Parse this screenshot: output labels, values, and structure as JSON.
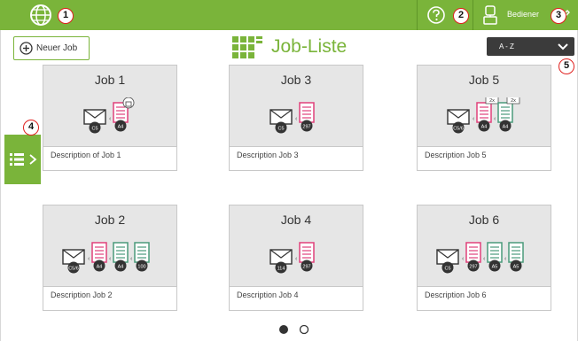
{
  "topbar": {
    "user_label": "Bediener",
    "bg_color": "#7ab43a",
    "icons": [
      "globe-icon",
      "help-icon",
      "user-icon",
      "edit-icon"
    ]
  },
  "callouts": [
    "1",
    "2",
    "3",
    "4",
    "5"
  ],
  "toolbar": {
    "new_job_label": "Neuer Job",
    "title": "Job-Liste",
    "sort_value": "A - Z"
  },
  "jobs": [
    {
      "name": "Job 1",
      "description": "Description of Job 1",
      "docs": [
        "A4"
      ],
      "env": "C5",
      "extra": "lock"
    },
    {
      "name": "Job 3",
      "description": "Description Job 3",
      "docs": [
        "297"
      ],
      "env": "C5"
    },
    {
      "name": "Job 5",
      "description": "Description Job 5",
      "docs": [
        "A4",
        "A4"
      ],
      "env": "C5/6",
      "counts": [
        "2x",
        "2x"
      ]
    },
    {
      "name": "Job 2",
      "description": "Description Job 2",
      "docs": [
        "A4",
        "A4",
        "100"
      ],
      "env": "C5/6"
    },
    {
      "name": "Job 4",
      "description": "Description Job 4",
      "docs": [
        "297"
      ],
      "env": "114"
    },
    {
      "name": "Job 6",
      "description": "Description Job 6",
      "docs": [
        "297",
        "A5",
        "A5"
      ],
      "env": "C5"
    }
  ],
  "pagination": {
    "current": 1,
    "total": 2
  }
}
